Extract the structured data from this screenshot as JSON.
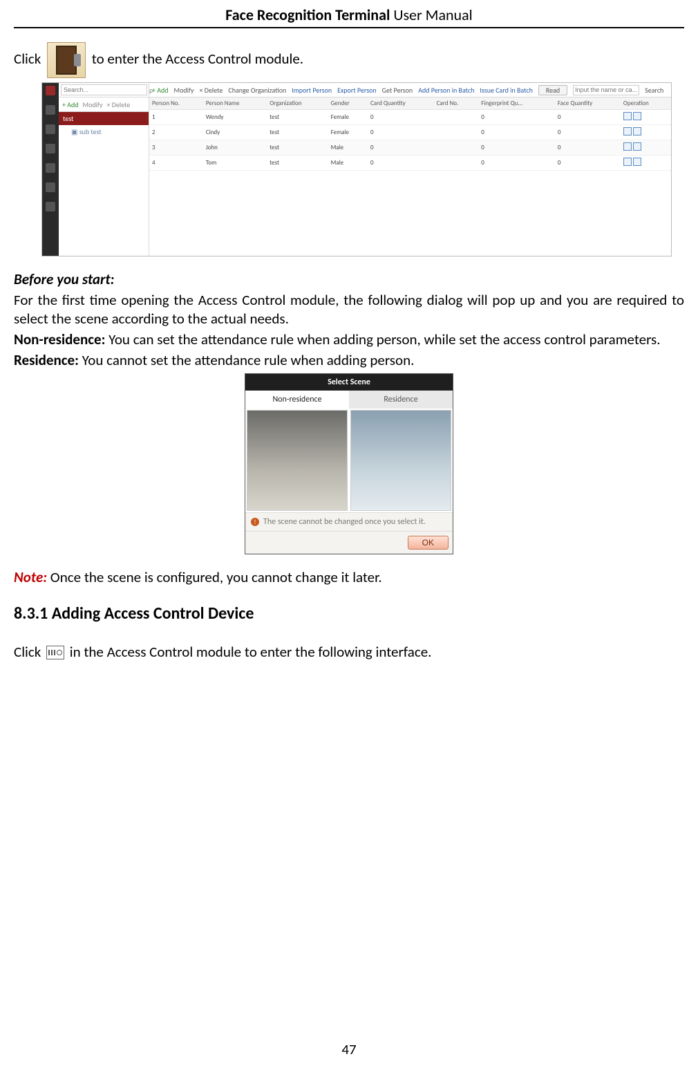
{
  "header": {
    "bold": "Face Recognition Terminal",
    "rest": " User Manual"
  },
  "intro": {
    "click": "Click ",
    "after": " to enter the Access Control module."
  },
  "scr1": {
    "search_placeholder": "Search...",
    "left_add": "+ Add",
    "left_modify": "Modify",
    "left_delete": "× Delete",
    "tree": [
      "test",
      "sub test"
    ],
    "main_tb": {
      "add": "+ Add",
      "modify": "Modify",
      "delete": "× Delete",
      "chorg": "Change Organization",
      "import": "Import Person",
      "export": "Export Person",
      "get": "Get Person",
      "batch": "Add Person in Batch",
      "issue": "Issue Card in Batch",
      "read": "Read",
      "name_ph": "Input the name or ca...",
      "search": "Search"
    },
    "cols": [
      "Person No.",
      "Person Name",
      "Organization",
      "Gender",
      "Card Quantity",
      "Card No.",
      "Fingerprint Qu...",
      "Face Quantity",
      "Operation"
    ],
    "rows": [
      {
        "no": "1",
        "name": "Wendy",
        "org": "test",
        "gender": "Female",
        "cq": "0",
        "cn": "",
        "fq": "0",
        "faq": "0"
      },
      {
        "no": "2",
        "name": "Cindy",
        "org": "test",
        "gender": "Female",
        "cq": "0",
        "cn": "",
        "fq": "0",
        "faq": "0"
      },
      {
        "no": "3",
        "name": "John",
        "org": "test",
        "gender": "Male",
        "cq": "0",
        "cn": "",
        "fq": "0",
        "faq": "0"
      },
      {
        "no": "4",
        "name": "Tom",
        "org": "test",
        "gender": "Male",
        "cq": "0",
        "cn": "",
        "fq": "0",
        "faq": "0"
      }
    ]
  },
  "before": {
    "hd": "Before you start:",
    "p1": "For the first time opening the Access Control module, the following dialog will pop up and you are required to select the scene according to the actual needs.",
    "nr": "Non-residence:",
    "nr_t": " You can set the attendance rule when adding person, while set the access control parameters.",
    "r": "Residence:",
    "r_t": " You cannot set the attendance rule when adding person."
  },
  "scr2": {
    "title": "Select Scene",
    "tab_a": "Non-residence",
    "tab_b": "Residence",
    "warn": "The scene cannot be changed once you select it.",
    "ok": "OK"
  },
  "note": {
    "lbl": "Note:",
    "t": " Once the scene is configured, you cannot change it later."
  },
  "sec": {
    "h": "8.3.1   Adding Access Control Device",
    "click": "Click ",
    "after": " in the Access Control module to enter the following interface."
  },
  "page": "47"
}
